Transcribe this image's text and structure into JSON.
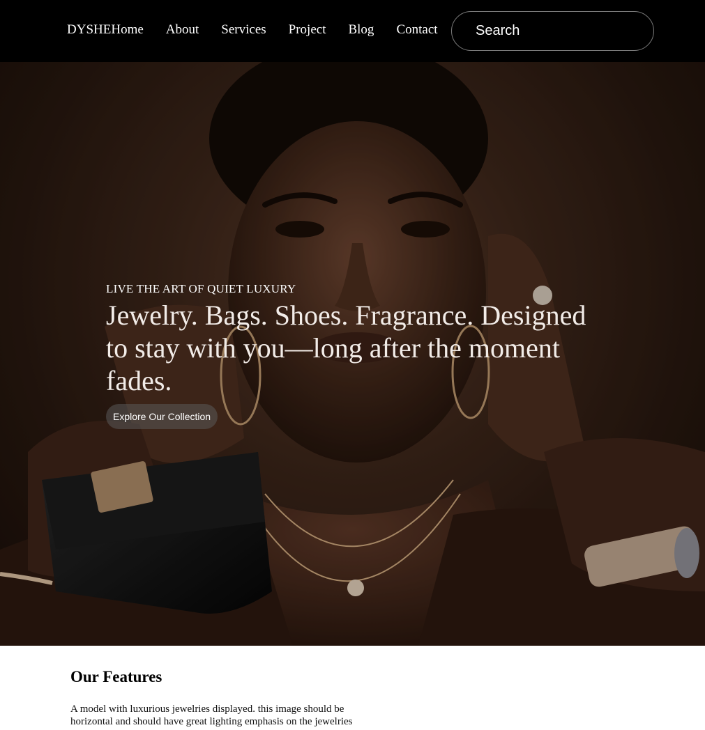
{
  "nav": {
    "brand": "DYSHE",
    "links": [
      "Home",
      "About",
      "Services",
      "Project",
      "Blog",
      "Contact"
    ],
    "search_placeholder": "Search"
  },
  "hero": {
    "eyebrow": "LIVE THE ART OF QUIET LUXURY",
    "headline": "Jewelry. Bags. Shoes. Fragrance. Designed to stay with you—long after the moment fades.",
    "cta_label": "Explore Our Collection",
    "image_subject": "model-with-jewelry-and-handbag-photo"
  },
  "features": {
    "title": "Our Features",
    "description": "A model with luxurious jewelries displayed. this image should be horizontal and should have great lighting emphasis on the jewelries"
  },
  "colors": {
    "nav_bg": "#000000",
    "hero_text": "#ffffff",
    "page_bg": "#ffffff"
  }
}
